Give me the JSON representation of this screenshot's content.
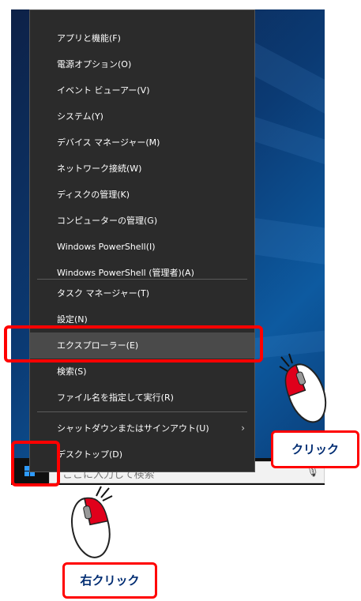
{
  "menu": {
    "items": [
      {
        "label": "アプリと機能(F)"
      },
      {
        "label": "電源オプション(O)"
      },
      {
        "label": "イベント ビューアー(V)"
      },
      {
        "label": "システム(Y)"
      },
      {
        "label": "デバイス マネージャー(M)"
      },
      {
        "label": "ネットワーク接続(W)"
      },
      {
        "label": "ディスクの管理(K)"
      },
      {
        "label": "コンピューターの管理(G)"
      },
      {
        "label": "Windows PowerShell(I)"
      },
      {
        "label": "Windows PowerShell (管理者)(A)"
      },
      {
        "label": "タスク マネージャー(T)"
      },
      {
        "label": "設定(N)"
      },
      {
        "label": "エクスプローラー(E)"
      },
      {
        "label": "検索(S)"
      },
      {
        "label": "ファイル名を指定して実行(R)"
      },
      {
        "label": "シャットダウンまたはサインアウト(U)",
        "submenu_glyph": "›"
      },
      {
        "label": "デスクトップ(D)"
      }
    ],
    "highlighted_index": 12
  },
  "taskbar": {
    "search_placeholder": "ここに入力して検索"
  },
  "annotations": {
    "click_label": "クリック",
    "right_click_label": "右クリック",
    "highlight_color": "#ff0000",
    "label_text_color": "#002c72"
  }
}
